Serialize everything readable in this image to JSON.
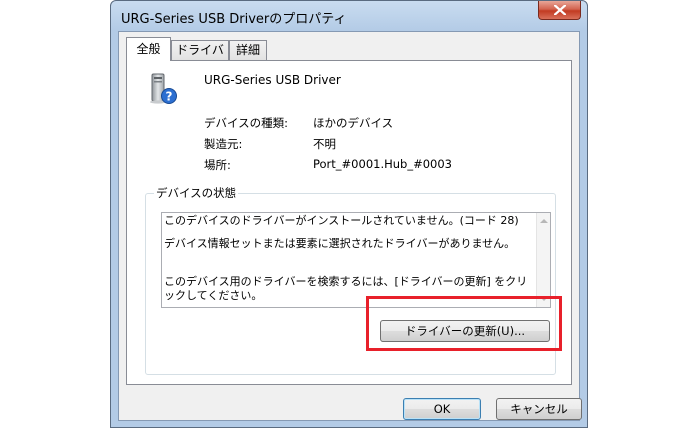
{
  "window": {
    "title": "URG-Series USB Driverのプロパティ"
  },
  "tabs": [
    {
      "label": "全般",
      "active": true
    },
    {
      "label": "ドライバー",
      "active": false
    },
    {
      "label": "詳細",
      "active": false
    }
  ],
  "device": {
    "name": "URG-Series USB Driver",
    "icon": "unknown-device-icon"
  },
  "properties": [
    {
      "label": "デバイスの種類:",
      "value": "ほかのデバイス"
    },
    {
      "label": "製造元:",
      "value": "不明"
    },
    {
      "label": "場所:",
      "value": "Port_#0001.Hub_#0003"
    }
  ],
  "status": {
    "legend": "デバイスの状態",
    "line1": "このデバイスのドライバーがインストールされていません。(コード 28)",
    "line2": "デバイス情報セットまたは要素に選択されたドライバーがありません。",
    "line3": "このデバイス用のドライバーを検索するには、[ドライバーの更新] をクリックしてください。"
  },
  "buttons": {
    "update_driver": "ドライバーの更新(U)...",
    "ok": "OK",
    "cancel": "キャンセル"
  },
  "colors": {
    "highlight": "#e8202a",
    "close_button": "#c23b22"
  }
}
